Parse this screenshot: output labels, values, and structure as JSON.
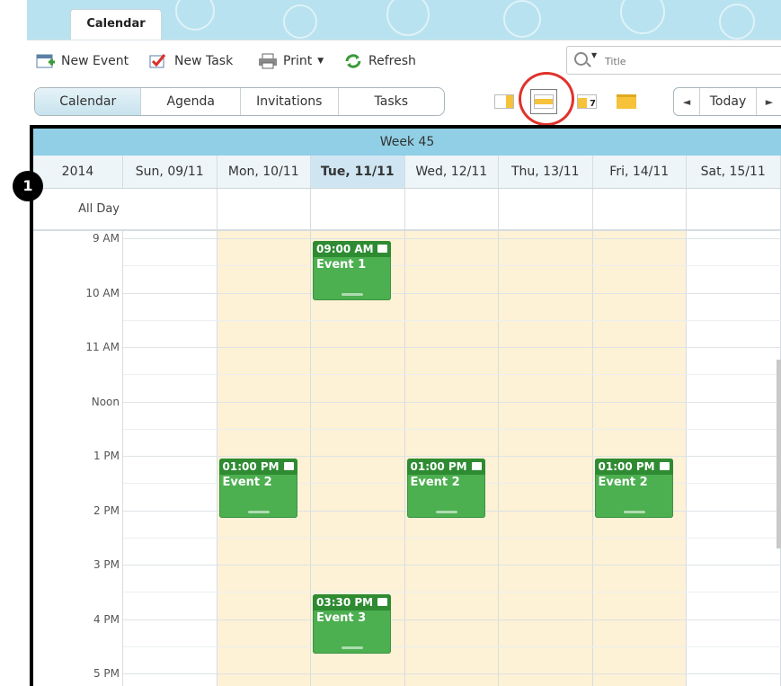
{
  "app_tab": "Calendar",
  "toolbar": {
    "new_event": "New Event",
    "new_task": "New Task",
    "print": "Print",
    "refresh": "Refresh",
    "search_placeholder": "Title"
  },
  "view_tabs": [
    "Calendar",
    "Agenda",
    "Invitations",
    "Tasks"
  ],
  "nav": {
    "today": "Today",
    "prev": "◄",
    "next": "►"
  },
  "calendar": {
    "week_label": "Week 45",
    "year": "2014",
    "all_day": "All Day",
    "days": [
      "Sun, 09/11",
      "Mon, 10/11",
      "Tue, 11/11",
      "Wed, 12/11",
      "Thu, 13/11",
      "Fri, 14/11",
      "Sat, 15/11"
    ],
    "today_index": 2,
    "times": [
      "9 AM",
      "10 AM",
      "11 AM",
      "Noon",
      "1 PM",
      "2 PM",
      "3 PM",
      "4 PM",
      "5 PM"
    ],
    "events": [
      {
        "day": 2,
        "start_hour": 9.0,
        "time": "09:00 AM",
        "title": "Event 1"
      },
      {
        "day": 1,
        "start_hour": 13.0,
        "time": "01:00 PM",
        "title": "Event 2"
      },
      {
        "day": 3,
        "start_hour": 13.0,
        "time": "01:00 PM",
        "title": "Event 2"
      },
      {
        "day": 5,
        "start_hour": 13.0,
        "time": "01:00 PM",
        "title": "Event 2"
      },
      {
        "day": 2,
        "start_hour": 15.5,
        "time": "03:30 PM",
        "title": "Event 3"
      }
    ]
  },
  "step_badge": "1",
  "colors": {
    "event_green": "#4caf50",
    "event_header": "#2e8b32",
    "work_hours": "#fdf1d6",
    "week_bar": "#90cfe5",
    "highlight": "#e0322b"
  }
}
